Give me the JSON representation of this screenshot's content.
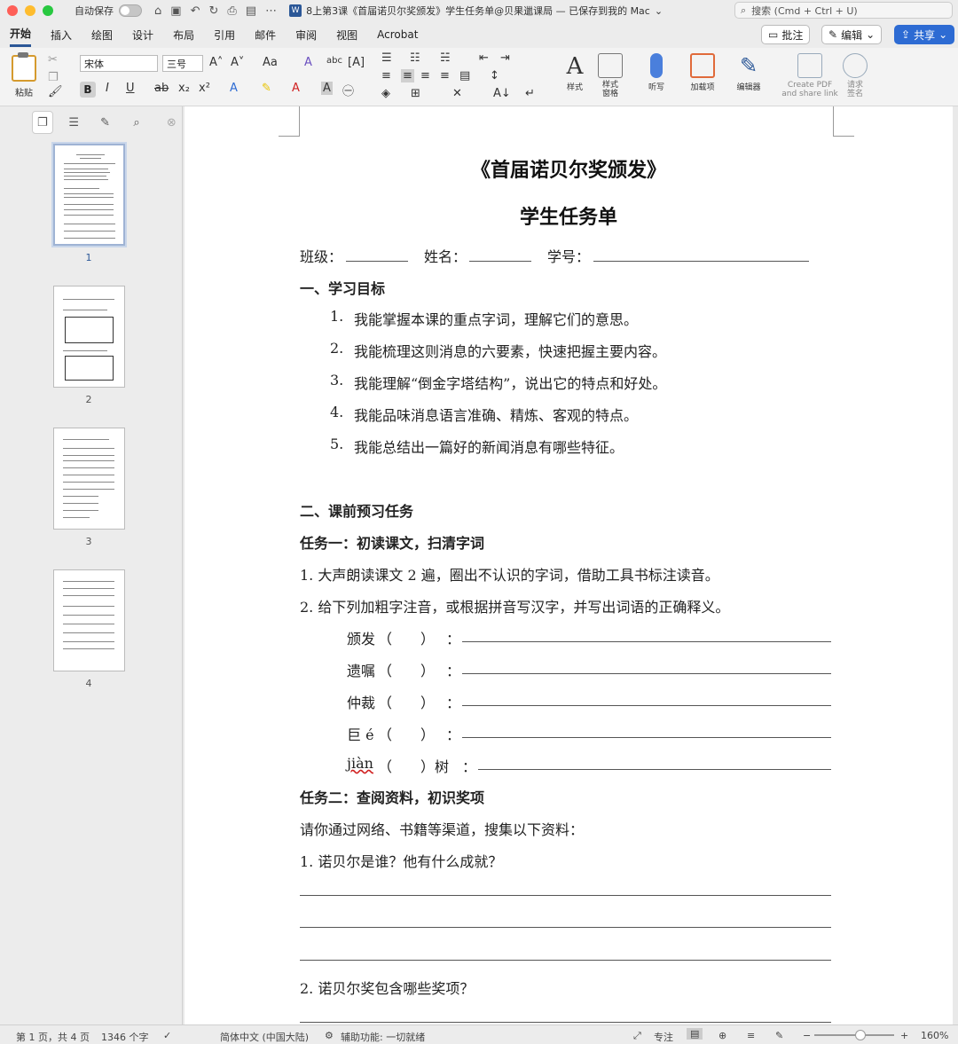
{
  "titlebar": {
    "autosave_label": "自动保存",
    "doc_title": "8上第3课《首届诺贝尔奖颁发》学生任务单@贝果邋课局 — 已保存到我的 Mac",
    "search_placeholder": "搜索 (Cmd + Ctrl + U)",
    "word_icon": "W"
  },
  "tabs": [
    "开始",
    "插入",
    "绘图",
    "设计",
    "布局",
    "引用",
    "邮件",
    "审阅",
    "视图",
    "Acrobat"
  ],
  "tab_buttons": {
    "comments": "批注",
    "editing": "编辑",
    "share": "共享"
  },
  "ribbon": {
    "paste": "粘贴",
    "font_name": "宋体",
    "font_size": "三号",
    "bold": "B",
    "italic": "I",
    "underline": "U",
    "strike": "ab",
    "subscript": "x₂",
    "superscript": "x²",
    "styles": "样式",
    "styles_pane": "样式\n窗格",
    "dictate": "听写",
    "addins": "加载项",
    "editor": "编辑器",
    "create_pdf": "Create PDF\nand share link",
    "request_sign": "请求\n签名"
  },
  "thumbnails": [
    "1",
    "2",
    "3",
    "4"
  ],
  "document": {
    "title": "《首届诺贝尔奖颁发》",
    "subtitle": "学生任务单",
    "class_label": "班级：",
    "name_label": "姓名：",
    "id_label": "学号：",
    "section1": "一、学习目标",
    "goals": [
      "我能掌握本课的重点字词，理解它们的意思。",
      "我能梳理这则消息的六要素，快速把握主要内容。",
      "我能理解“倒金字塔结构”，说出它的特点和好处。",
      "我能品味消息语言准确、精炼、客观的特点。",
      "我能总结出一篇好的新闻消息有哪些特征。"
    ],
    "goal_numbers": [
      "1.",
      "2.",
      "3.",
      "4.",
      "5."
    ],
    "section2": "二、课前预习任务",
    "task1_title": "任务一：初读课文，扫清字词",
    "task1_items": [
      "1. 大声朗读课文 2 遍，圈出不认识的字词，借助工具书标注读音。",
      "2. 给下列加粗字注音，或根据拼音写汉字，并写出词语的正确释义。"
    ],
    "words": [
      {
        "word": "颁发",
        "paren": "（　　）",
        "colon": "："
      },
      {
        "word": "遗嘱",
        "paren": "（　　）",
        "colon": "："
      },
      {
        "word": "仲裁",
        "paren": "（　　）",
        "colon": "："
      },
      {
        "word": "巨 é",
        "paren": "（　　）",
        "colon": "："
      },
      {
        "word": "jiàn",
        "paren": "（　　）树",
        "colon": "："
      }
    ],
    "task2_title": "任务二：查阅资料，初识奖项",
    "task2_intro": "请你通过网络、书籍等渠道，搜集以下资料：",
    "q1": "1.  诺贝尔是谁？他有什么成就？",
    "q2": "2.  诺贝尔奖包含哪些奖项？"
  },
  "statusbar": {
    "page": "第 1 页，共 4 页",
    "words": "1346 个字",
    "language": "简体中文 (中国大陆)",
    "accessibility": "辅助功能: 一切就绪",
    "focus": "专注",
    "zoom": "160%"
  },
  "colors": {
    "accent": "#2b5797",
    "share": "#2d6bd3",
    "red_light": "#fe5f57",
    "yellow_light": "#febc2e",
    "green_light": "#28c840"
  }
}
